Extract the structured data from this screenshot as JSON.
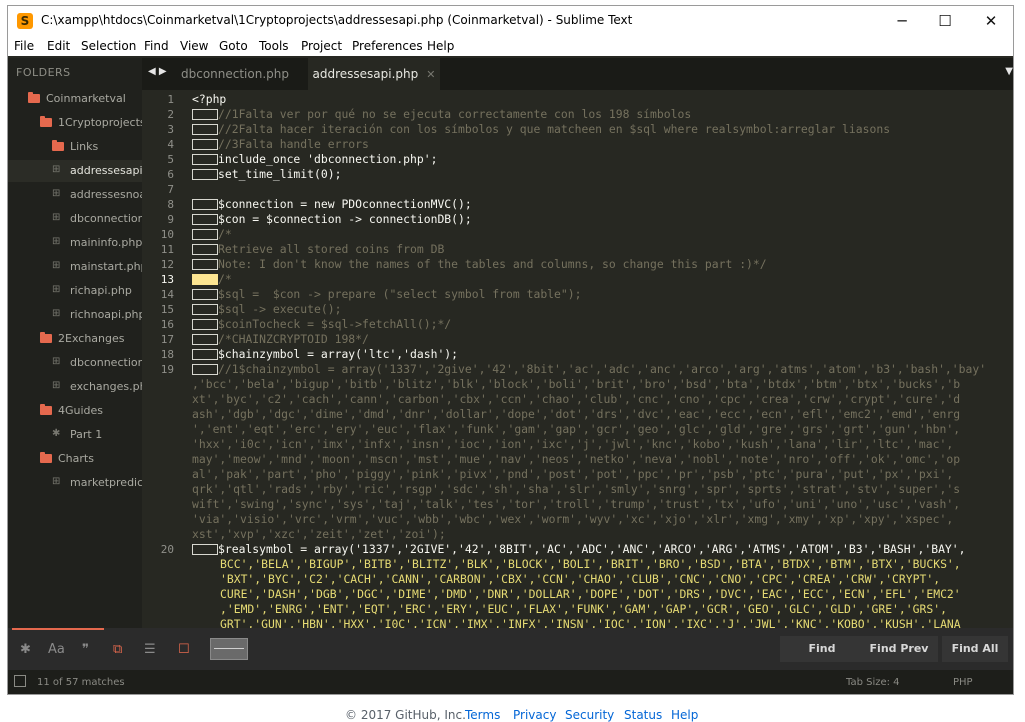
{
  "window": {
    "title": "C:\\xampp\\htdocs\\Coinmarketval\\1Cryptoprojects\\addressesapi.php (Coinmarketval) - Sublime Text",
    "app_icon_letter": "S",
    "buttons": {
      "minimize": "─",
      "maximize": "☐",
      "close": "✕"
    }
  },
  "menu": [
    "File",
    "Edit",
    "Selection",
    "Find",
    "View",
    "Goto",
    "Tools",
    "Project",
    "Preferences",
    "Help"
  ],
  "sidebar": {
    "header": "FOLDERS",
    "items": [
      {
        "label": "Coinmarketval",
        "kind": "folder"
      },
      {
        "label": "1Cryptoprojects",
        "kind": "folder"
      },
      {
        "label": "Links",
        "kind": "folder"
      },
      {
        "label": "addressesapi.php",
        "kind": "file",
        "active": true
      },
      {
        "label": "addressesnoapi.php",
        "kind": "file"
      },
      {
        "label": "dbconnection.php",
        "kind": "file"
      },
      {
        "label": "maininfo.php",
        "kind": "file"
      },
      {
        "label": "mainstart.php",
        "kind": "file"
      },
      {
        "label": "richapi.php",
        "kind": "file"
      },
      {
        "label": "richnoapi.php",
        "kind": "file"
      },
      {
        "label": "2Exchanges",
        "kind": "folder"
      },
      {
        "label": "dbconnection.php",
        "kind": "file"
      },
      {
        "label": "exchanges.php",
        "kind": "file"
      },
      {
        "label": "4Guides",
        "kind": "folder"
      },
      {
        "label": "Part 1",
        "kind": "asterisk"
      },
      {
        "label": "Charts",
        "kind": "folder"
      },
      {
        "label": "marketprediction.php",
        "kind": "file"
      }
    ]
  },
  "tabs": {
    "arrows": "◀ ▶",
    "items": [
      {
        "label": "dbconnection.php",
        "active": false
      },
      {
        "label": "addressesapi.php",
        "active": true
      }
    ],
    "close_glyph": "✕",
    "dropdown": "▼"
  },
  "editor": {
    "line_numbers": [
      "1",
      "2",
      "3",
      "4",
      "5",
      "6",
      "7",
      "8",
      "9",
      "10",
      "11",
      "12",
      "13",
      "14",
      "15",
      "16",
      "17",
      "18",
      "19",
      "20"
    ],
    "current_line": "13",
    "lines": [
      "<?php",
      "//1Falta ver por qué no se ejecuta correctamente con los 198 símbolos",
      "//2Falta hacer iteración con los símbolos y que matcheen en $sql where realsymbol:arreglar liasons",
      "//3Falta handle errors",
      "include_once 'dbconnection.php';",
      "set_time_limit(0);",
      "",
      "$connection = new PDOconnectionMVC();",
      "$con = $connection -> connectionDB();",
      "/*",
      "Retrieve all stored coins from DB",
      "Note: I don't know the names of the tables and columns, so change this part :)*/",
      "/*",
      "$sql =  $con -> prepare (\"select symbol from table\");",
      "$sql -> execute();",
      "$coinTocheck = $sql->fetchAll();*/",
      "/*CHAINZCRYPTOID 198*/",
      "$chainzymbol = array('ltc','dash');",
      "//1$chainzymbol = array('1337','2give','42','8bit','ac','adc','anc','arco','arg','atms','atom','b3','bash','bay'",
      ",'bcc','bela','bigup','bitb','blitz','blk','block','boli','brit','bro','bsd','bta','btdx','btm','btx','bucks','b",
      "xt','byc','c2','cach','cann','carbon','cbx','ccn','chao','club','cnc','cno','cpc','crea','crw','crypt','cure','d",
      "ash','dgb','dgc','dime','dmd','dnr','dollar','dope','dot','drs','dvc','eac','ecc','ecn','efl','emc2','emd','enrg",
      "','ent','eqt','erc','ery','euc','flax','funk','gam','gap','gcr','geo','glc','gld','gre','grs','grt','gun','hbn',",
      "'hxx','i0c','icn','imx','infx','insn','ioc','ion','ixc','j','jwl','knc','kobo','kush','lana','lir','ltc','mac',",
      "may','meow','mnd','moon','mscn','mst','mue','nav','neos','netko','neva','nobl','note','nro','off','ok','omc','op",
      "al','pak','part','pho','piggy','pink','pivx','pnd','post','pot','ppc','pr','psb','ptc','pura','put','px','pxi',",
      "qrk','qtl','rads','rby','ric','rsgp','sdc','sh','sha','slr','smly','snrg','spr','sprts','strat','stv','super','s",
      "wift','swing','sync','sys','taj','talk','tes','tor','troll','trump','trust','tx','ufo','uni','uno','usc','vash',",
      "'via','visio','vrc','vrm','vuc','wbb','wbc','wex','worm','wyv','xc','xjo','xlr','xmg','xmy','xp','xpy','xspec',",
      "xst','xvp','xzc','zeit','zet','zoi');",
      "$realsymbol = array('1337','2GIVE','42','8BIT','AC','ADC','ANC','ARCO','ARG','ATMS','ATOM','B3','BASH','BAY',",
      "BCC','BELA','BIGUP','BITB','BLITZ','BLK','BLOCK','BOLI','BRIT','BRO','BSD','BTA','BTDX','BTM','BTX','BUCKS',",
      "'BXT','BYC','C2','CACH','CANN','CARBON','CBX','CCN','CHAO','CLUB','CNC','CNO','CPC','CREA','CRW','CRYPT',",
      "CURE','DASH','DGB','DGC','DIME','DMD','DNR','DOLLAR','DOPE','DOT','DRS','DVC','EAC','ECC','ECN','EFL','EMC2'",
      ",'EMD','ENRG','ENT','EQT','ERC','ERY','EUC','FLAX','FUNK','GAM','GAP','GCR','GEO','GLC','GLD','GRE','GRS',",
      "GRT','GUN','HBN','HXX','I0C','ICN','IMX','INFX','INSN','IOC','ION','IXC','J','JWL','KNC','KOBO','KUSH','LANA"
    ]
  },
  "findbar": {
    "options": [
      "✱",
      "Aa",
      "❞",
      "⧉",
      "☰",
      "☐"
    ],
    "buttons": [
      "Find",
      "Find Prev",
      "Find All"
    ]
  },
  "status": {
    "matches": "11 of 57 matches",
    "tab_size": "Tab Size: 4",
    "syntax": "PHP"
  },
  "footer": {
    "copyright": "© 2017 GitHub, Inc.",
    "links": [
      "Terms",
      "Privacy",
      "Security",
      "Status",
      "Help"
    ]
  }
}
